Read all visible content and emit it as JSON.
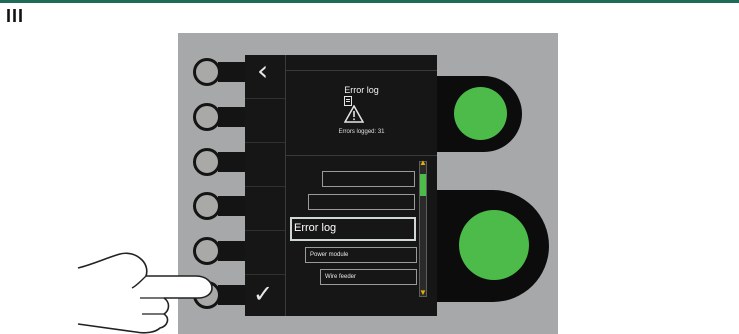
{
  "section_label": "III",
  "screen": {
    "back_icon": "‹",
    "confirm_icon": "✓",
    "info": {
      "title": "Error log",
      "errors_logged": "Errors logged: 31"
    },
    "list": {
      "items": [
        {
          "label": ""
        },
        {
          "label": ""
        },
        {
          "label": "Error log"
        },
        {
          "label": "Power module"
        },
        {
          "label": "Wire feeder"
        }
      ]
    }
  },
  "icons": {
    "back": "chevron-left-icon",
    "confirm": "checkmark-icon",
    "document": "document-icon",
    "warning": "warning-triangle-icon",
    "scroll_up": "arrow-up-icon",
    "scroll_down": "arrow-down-icon",
    "hand": "pointing-hand-icon"
  },
  "colors": {
    "accent": "#1e6b56",
    "knob": "#4dbb4a",
    "scroll_arrow": "#e2b100",
    "panel": "#a7a8aa",
    "screen": "#161616"
  }
}
